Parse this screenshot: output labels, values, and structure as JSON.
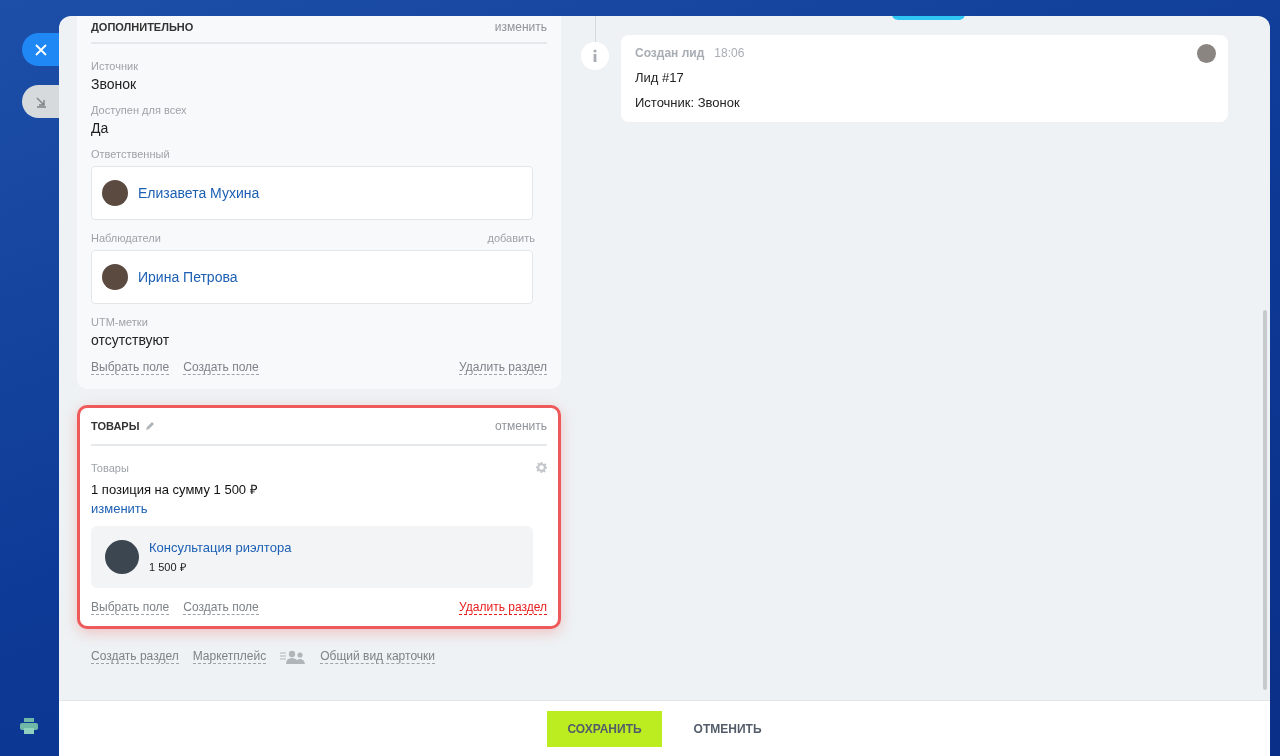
{
  "sections": [
    {
      "kind": "fields",
      "title": "ДОПОЛНИТЕЛЬНО",
      "action": "изменить",
      "highlighted": false,
      "fields": [
        {
          "kind": "text",
          "label": "Источник",
          "value": "Звонок"
        },
        {
          "kind": "text",
          "label": "Доступен для всех",
          "value": "Да"
        },
        {
          "kind": "user",
          "label": "Ответственный",
          "user": "Елизавета Мухина"
        },
        {
          "kind": "user",
          "label": "Наблюдатели",
          "action": "добавить",
          "user": "Ирина Петрова"
        },
        {
          "kind": "text",
          "label": "UTM-метки",
          "value": "отсутствуют"
        }
      ],
      "footer_links": [
        "Выбрать поле",
        "Создать поле"
      ],
      "delete_link": "Удалить раздел"
    },
    {
      "kind": "products",
      "title": "ТОВАРЫ",
      "action": "отменить",
      "highlighted": true,
      "fields": [
        {
          "kind": "products",
          "label": "Товары",
          "summary": "1 позиция на сумму 1 500 ₽",
          "edit_link": "изменить",
          "items": [
            {
              "name": "Консультация риэлтора",
              "price": "1 500 ₽"
            }
          ]
        }
      ],
      "footer_links": [
        "Выбрать поле",
        "Создать поле"
      ],
      "delete_link": "Удалить раздел"
    }
  ],
  "bottom_links": [
    {
      "kind": "plain",
      "label": "Создать раздел"
    },
    {
      "kind": "plain",
      "label": "Маркетплейс"
    },
    {
      "kind": "icon",
      "label": "Общий вид карточки"
    }
  ],
  "timeline": [
    {
      "title": "Создан лид",
      "time": "18:06",
      "lines": [
        "Лид #17",
        "Источник: Звонок"
      ]
    }
  ],
  "footer_buttons": [
    {
      "kind": "primary",
      "label": "СОХРАНИТЬ"
    },
    {
      "kind": "plain",
      "label": "ОТМЕНИТЬ"
    }
  ]
}
